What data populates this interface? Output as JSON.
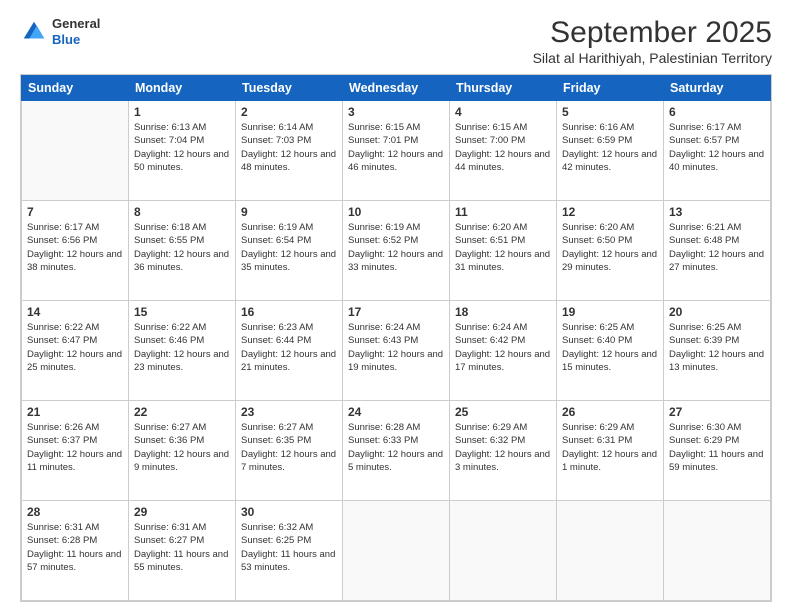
{
  "header": {
    "logo_general": "General",
    "logo_blue": "Blue",
    "title": "September 2025",
    "subtitle": "Silat al Harithiyah, Palestinian Territory"
  },
  "days_of_week": [
    "Sunday",
    "Monday",
    "Tuesday",
    "Wednesday",
    "Thursday",
    "Friday",
    "Saturday"
  ],
  "weeks": [
    [
      {
        "day": "",
        "sunrise": "",
        "sunset": "",
        "daylight": ""
      },
      {
        "day": "1",
        "sunrise": "Sunrise: 6:13 AM",
        "sunset": "Sunset: 7:04 PM",
        "daylight": "Daylight: 12 hours and 50 minutes."
      },
      {
        "day": "2",
        "sunrise": "Sunrise: 6:14 AM",
        "sunset": "Sunset: 7:03 PM",
        "daylight": "Daylight: 12 hours and 48 minutes."
      },
      {
        "day": "3",
        "sunrise": "Sunrise: 6:15 AM",
        "sunset": "Sunset: 7:01 PM",
        "daylight": "Daylight: 12 hours and 46 minutes."
      },
      {
        "day": "4",
        "sunrise": "Sunrise: 6:15 AM",
        "sunset": "Sunset: 7:00 PM",
        "daylight": "Daylight: 12 hours and 44 minutes."
      },
      {
        "day": "5",
        "sunrise": "Sunrise: 6:16 AM",
        "sunset": "Sunset: 6:59 PM",
        "daylight": "Daylight: 12 hours and 42 minutes."
      },
      {
        "day": "6",
        "sunrise": "Sunrise: 6:17 AM",
        "sunset": "Sunset: 6:57 PM",
        "daylight": "Daylight: 12 hours and 40 minutes."
      }
    ],
    [
      {
        "day": "7",
        "sunrise": "Sunrise: 6:17 AM",
        "sunset": "Sunset: 6:56 PM",
        "daylight": "Daylight: 12 hours and 38 minutes."
      },
      {
        "day": "8",
        "sunrise": "Sunrise: 6:18 AM",
        "sunset": "Sunset: 6:55 PM",
        "daylight": "Daylight: 12 hours and 36 minutes."
      },
      {
        "day": "9",
        "sunrise": "Sunrise: 6:19 AM",
        "sunset": "Sunset: 6:54 PM",
        "daylight": "Daylight: 12 hours and 35 minutes."
      },
      {
        "day": "10",
        "sunrise": "Sunrise: 6:19 AM",
        "sunset": "Sunset: 6:52 PM",
        "daylight": "Daylight: 12 hours and 33 minutes."
      },
      {
        "day": "11",
        "sunrise": "Sunrise: 6:20 AM",
        "sunset": "Sunset: 6:51 PM",
        "daylight": "Daylight: 12 hours and 31 minutes."
      },
      {
        "day": "12",
        "sunrise": "Sunrise: 6:20 AM",
        "sunset": "Sunset: 6:50 PM",
        "daylight": "Daylight: 12 hours and 29 minutes."
      },
      {
        "day": "13",
        "sunrise": "Sunrise: 6:21 AM",
        "sunset": "Sunset: 6:48 PM",
        "daylight": "Daylight: 12 hours and 27 minutes."
      }
    ],
    [
      {
        "day": "14",
        "sunrise": "Sunrise: 6:22 AM",
        "sunset": "Sunset: 6:47 PM",
        "daylight": "Daylight: 12 hours and 25 minutes."
      },
      {
        "day": "15",
        "sunrise": "Sunrise: 6:22 AM",
        "sunset": "Sunset: 6:46 PM",
        "daylight": "Daylight: 12 hours and 23 minutes."
      },
      {
        "day": "16",
        "sunrise": "Sunrise: 6:23 AM",
        "sunset": "Sunset: 6:44 PM",
        "daylight": "Daylight: 12 hours and 21 minutes."
      },
      {
        "day": "17",
        "sunrise": "Sunrise: 6:24 AM",
        "sunset": "Sunset: 6:43 PM",
        "daylight": "Daylight: 12 hours and 19 minutes."
      },
      {
        "day": "18",
        "sunrise": "Sunrise: 6:24 AM",
        "sunset": "Sunset: 6:42 PM",
        "daylight": "Daylight: 12 hours and 17 minutes."
      },
      {
        "day": "19",
        "sunrise": "Sunrise: 6:25 AM",
        "sunset": "Sunset: 6:40 PM",
        "daylight": "Daylight: 12 hours and 15 minutes."
      },
      {
        "day": "20",
        "sunrise": "Sunrise: 6:25 AM",
        "sunset": "Sunset: 6:39 PM",
        "daylight": "Daylight: 12 hours and 13 minutes."
      }
    ],
    [
      {
        "day": "21",
        "sunrise": "Sunrise: 6:26 AM",
        "sunset": "Sunset: 6:37 PM",
        "daylight": "Daylight: 12 hours and 11 minutes."
      },
      {
        "day": "22",
        "sunrise": "Sunrise: 6:27 AM",
        "sunset": "Sunset: 6:36 PM",
        "daylight": "Daylight: 12 hours and 9 minutes."
      },
      {
        "day": "23",
        "sunrise": "Sunrise: 6:27 AM",
        "sunset": "Sunset: 6:35 PM",
        "daylight": "Daylight: 12 hours and 7 minutes."
      },
      {
        "day": "24",
        "sunrise": "Sunrise: 6:28 AM",
        "sunset": "Sunset: 6:33 PM",
        "daylight": "Daylight: 12 hours and 5 minutes."
      },
      {
        "day": "25",
        "sunrise": "Sunrise: 6:29 AM",
        "sunset": "Sunset: 6:32 PM",
        "daylight": "Daylight: 12 hours and 3 minutes."
      },
      {
        "day": "26",
        "sunrise": "Sunrise: 6:29 AM",
        "sunset": "Sunset: 6:31 PM",
        "daylight": "Daylight: 12 hours and 1 minute."
      },
      {
        "day": "27",
        "sunrise": "Sunrise: 6:30 AM",
        "sunset": "Sunset: 6:29 PM",
        "daylight": "Daylight: 11 hours and 59 minutes."
      }
    ],
    [
      {
        "day": "28",
        "sunrise": "Sunrise: 6:31 AM",
        "sunset": "Sunset: 6:28 PM",
        "daylight": "Daylight: 11 hours and 57 minutes."
      },
      {
        "day": "29",
        "sunrise": "Sunrise: 6:31 AM",
        "sunset": "Sunset: 6:27 PM",
        "daylight": "Daylight: 11 hours and 55 minutes."
      },
      {
        "day": "30",
        "sunrise": "Sunrise: 6:32 AM",
        "sunset": "Sunset: 6:25 PM",
        "daylight": "Daylight: 11 hours and 53 minutes."
      },
      {
        "day": "",
        "sunrise": "",
        "sunset": "",
        "daylight": ""
      },
      {
        "day": "",
        "sunrise": "",
        "sunset": "",
        "daylight": ""
      },
      {
        "day": "",
        "sunrise": "",
        "sunset": "",
        "daylight": ""
      },
      {
        "day": "",
        "sunrise": "",
        "sunset": "",
        "daylight": ""
      }
    ]
  ]
}
